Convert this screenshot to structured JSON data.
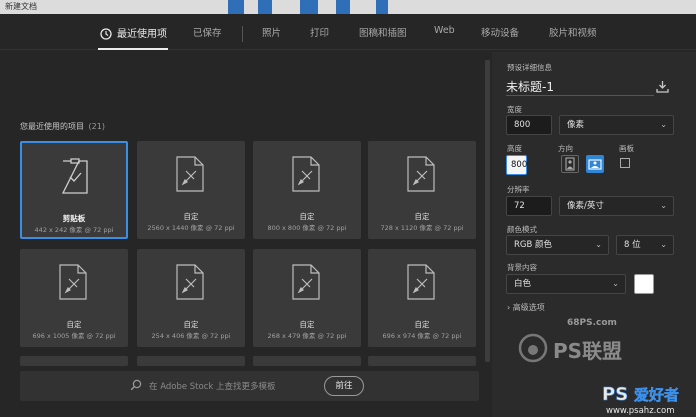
{
  "window": {
    "title": "新建文档"
  },
  "tabs": [
    {
      "label": "最近使用项",
      "active": true
    },
    {
      "label": "已保存"
    },
    {
      "label": "照片"
    },
    {
      "label": "打印"
    },
    {
      "label": "图稿和插图"
    },
    {
      "label": "Web"
    },
    {
      "label": "移动设备"
    },
    {
      "label": "胶片和视频"
    }
  ],
  "recent": {
    "title": "您最近使用的项目",
    "count": "(21)",
    "items": [
      {
        "name": "剪贴板",
        "size": "442 x 242 像素 @ 72 ppi",
        "selected": true
      },
      {
        "name": "自定",
        "size": "2560 x 1440 像素 @ 72 ppi"
      },
      {
        "name": "自定",
        "size": "800 x 800 像素 @ 72 ppi"
      },
      {
        "name": "自定",
        "size": "728 x 1120 像素 @ 72 ppi"
      },
      {
        "name": "自定",
        "size": "696 x 1005 像素 @ 72 ppi"
      },
      {
        "name": "自定",
        "size": "254 x 406 像素 @ 72 ppi"
      },
      {
        "name": "自定",
        "size": "268 x 479 像素 @ 72 ppi"
      },
      {
        "name": "自定",
        "size": "696 x 974 像素 @ 72 ppi"
      }
    ]
  },
  "search": {
    "placeholder": "在 Adobe Stock 上查找更多模板",
    "button": "前往"
  },
  "preset": {
    "section_label": "预设详细信息",
    "doc_title": "未标题-1",
    "width_label": "宽度",
    "width_value": "800",
    "width_unit": "像素",
    "height_label": "高度",
    "height_value": "800",
    "orientation_label": "方向",
    "artboard_label": "画板",
    "resolution_label": "分辨率",
    "resolution_value": "72",
    "resolution_unit": "像素/英寸",
    "colormode_label": "颜色模式",
    "colormode_value": "RGB 颜色",
    "bitdepth_value": "8 位",
    "background_label": "背景内容",
    "background_value": "白色",
    "advanced_label": "高级选项"
  },
  "watermark": {
    "site": "68PS.com",
    "brand": "PS联盟",
    "bottom_brand": "PS爱好者",
    "bottom_url": "www.psahz.com"
  },
  "colors": {
    "accent": "#3b8ee8",
    "orient_active": "#2f86d6",
    "panel": "#2b2b2b",
    "card": "#3a3a3a"
  }
}
